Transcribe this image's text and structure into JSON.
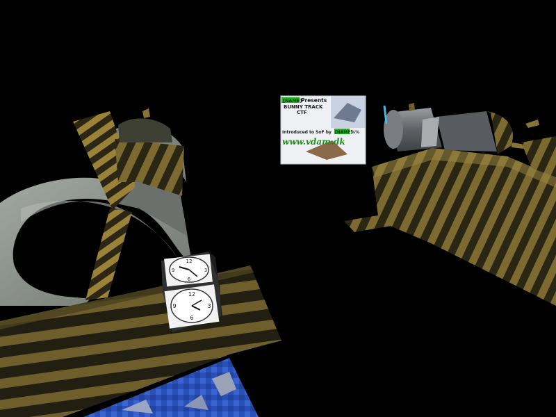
{
  "poster": {
    "tag_1": "[NAME]",
    "line_1": "Presents",
    "line_2": "BUNNY TRACK",
    "line_3": "CTF",
    "line_4_prefix": "Introduced to SoF by",
    "tag_2": "[NAME]",
    "line_4_suffix": "%%",
    "url": "www.vdam.dk"
  },
  "clock_faces": {
    "top": [
      "12",
      "3",
      "6",
      "9"
    ],
    "bottom": [
      "12",
      "3",
      "6",
      "9"
    ]
  },
  "colors": {
    "sky": "#000000",
    "stripe_dark": "#2a2614",
    "stripe_light": "#8a7434",
    "rock": "#8c918c",
    "poster_green": "#18b818",
    "water_blue": "#2a4fb8"
  }
}
